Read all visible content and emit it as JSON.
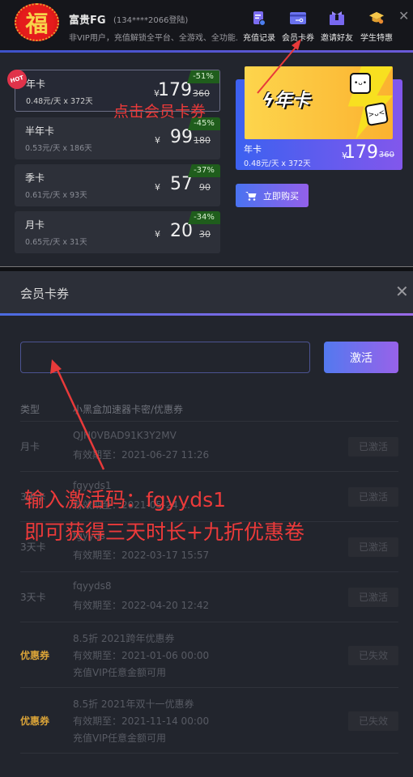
{
  "header": {
    "avatar_char": "福",
    "username": "富贵FG",
    "phone_login": "(134****2066登陆)",
    "note": "非VIP用户，充值解锁全平台、全游戏、全功能...",
    "nav": [
      {
        "label": "充值记录",
        "icon": "recharge-record-icon",
        "color": "#7b6cf0"
      },
      {
        "label": "会员卡券",
        "icon": "member-card-icon",
        "color": "#6a72ee"
      },
      {
        "label": "邀请好友",
        "icon": "gift-icon",
        "color": "#7868f0"
      },
      {
        "label": "学生特惠",
        "icon": "graduation-cap-icon",
        "color": "#f0b840"
      }
    ],
    "close": "✕"
  },
  "plans": [
    {
      "name": "年卡",
      "sub": "0.48元/天 x 372天",
      "currency": "¥",
      "price": "179",
      "old": "360",
      "discount": "-51%",
      "selected": true,
      "badge": "HOT"
    },
    {
      "name": "半年卡",
      "sub": "0.53元/天 x 186天",
      "currency": "¥",
      "price": "99",
      "old": "180",
      "discount": "-45%"
    },
    {
      "name": "季卡",
      "sub": "0.61元/天 x 93天",
      "currency": "¥",
      "price": "57",
      "old": "90",
      "discount": "-37%"
    },
    {
      "name": "月卡",
      "sub": "0.65元/天 x 31天",
      "currency": "¥",
      "price": "20",
      "old": "30",
      "discount": "-34%"
    }
  ],
  "banner": {
    "image_title": "年卡",
    "name": "年卡",
    "sub": "0.48元/天 x 372天",
    "currency": "¥",
    "price": "179",
    "old": "360",
    "buy_label": "立即购买"
  },
  "modal": {
    "title": "会员卡券",
    "close": "✕",
    "input_value": "",
    "input_placeholder": "",
    "activate_label": "激活",
    "columns": [
      "类型",
      "小黑盒加速器卡密/优惠券"
    ],
    "rows": [
      {
        "type": "月卡",
        "lines": [
          "QJH0VBAD91K3Y2MV",
          "有效期至：2021-06-27 11:26"
        ],
        "status": "已激活"
      },
      {
        "type": "3天卡",
        "lines": [
          "fgyyds1",
          "有效期至：2021-05-24 ..."
        ],
        "status": "已激活"
      },
      {
        "type": "3天卡",
        "lines": [
          "fgyyds...",
          "有效期至：2022-03-17 15:57"
        ],
        "status": "已激活"
      },
      {
        "type": "3天卡",
        "lines": [
          "fqyyds8",
          "有效期至：2022-04-20 12:42"
        ],
        "status": "已激活"
      },
      {
        "type": "优惠券",
        "coupon": true,
        "lines": [
          "8.5折 2021跨年优惠券",
          "有效期至：2021-01-06 00:00",
          "充值VIP任意金额可用"
        ],
        "status": "已失效"
      },
      {
        "type": "优惠券",
        "coupon": true,
        "lines": [
          "8.5折 2021年双十一优惠券",
          "有效期至：2021-11-14 00:00",
          "充值VIP任意金额可用"
        ],
        "status": "已失效"
      }
    ]
  },
  "annotations": {
    "click_hint": "点击会员卡券",
    "input_hint": "输入激活码：fgyyds1",
    "benefit_hint": "即可获得三天时长+九折优惠卷",
    "color": "#ec3a3a"
  }
}
